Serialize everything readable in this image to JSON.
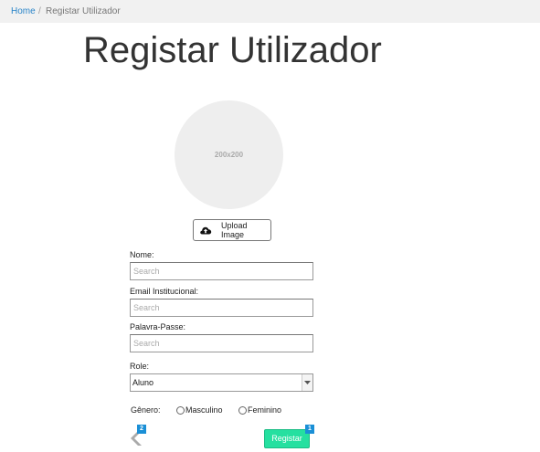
{
  "breadcrumb": {
    "home": "Home",
    "separator": "/",
    "current": "Registar Utilizador"
  },
  "page_title": "Registar Utilizador",
  "avatar": {
    "placeholder_text": "200x200"
  },
  "upload": {
    "label": "Upload Image",
    "icon": "cloud-upload-icon"
  },
  "form": {
    "nome": {
      "label": "Nome:",
      "placeholder": "Search",
      "value": ""
    },
    "email": {
      "label": "Email Institucional:",
      "placeholder": "Search",
      "value": ""
    },
    "password": {
      "label": "Palavra-Passe:",
      "placeholder": "Search",
      "value": ""
    },
    "role": {
      "label": "Role:",
      "selected": "Aluno"
    },
    "genero": {
      "label": "Gênero:",
      "options": [
        "Masculino",
        "Feminino"
      ]
    }
  },
  "actions": {
    "back_badge": "2",
    "submit_label": "Registar",
    "submit_badge": "1"
  },
  "colors": {
    "link": "#2a85c9",
    "submit": "#25e0a0",
    "badge": "#1a8fd6"
  }
}
